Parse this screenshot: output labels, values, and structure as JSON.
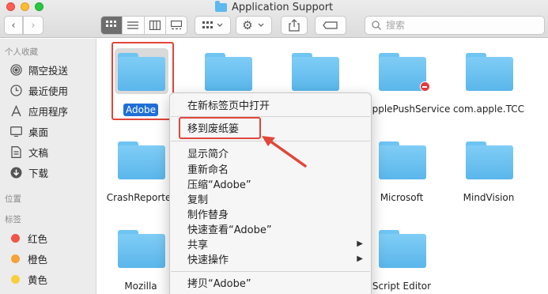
{
  "window": {
    "title": "Application Support"
  },
  "toolbar": {
    "back": "‹",
    "forward": "›",
    "view_modes": [
      "icon-view",
      "list-view",
      "column-view",
      "gallery-view"
    ],
    "search_placeholder": "搜索"
  },
  "sidebar": {
    "favorites_header": "个人收藏",
    "favorites": [
      {
        "label": "隔空投送",
        "icon": "airdrop-icon"
      },
      {
        "label": "最近使用",
        "icon": "clock-icon"
      },
      {
        "label": "应用程序",
        "icon": "apps-icon"
      },
      {
        "label": "桌面",
        "icon": "desktop-icon"
      },
      {
        "label": "文稿",
        "icon": "document-icon"
      },
      {
        "label": "下载",
        "icon": "download-icon"
      }
    ],
    "locations_header": "位置",
    "tags_header": "标签",
    "tags": [
      {
        "label": "红色",
        "color": "#f0544a"
      },
      {
        "label": "橙色",
        "color": "#f5a23a"
      },
      {
        "label": "黄色",
        "color": "#f6cf3c"
      }
    ]
  },
  "files": [
    {
      "label": "Adobe",
      "selected": true
    },
    {
      "label": ""
    },
    {
      "label": ""
    },
    {
      "label": "pplePushService",
      "no_entry": true
    },
    {
      "label": "com.apple.TCC"
    },
    {
      "label": "CrashReporter"
    },
    {
      "label": "Microsoft"
    },
    {
      "label": "MindVision"
    },
    {
      "label": "Mozilla"
    },
    {
      "label": "Script Editor"
    }
  ],
  "context_menu": {
    "open_new_tab": "在新标签页中打开",
    "move_to_trash": "移到废纸篓",
    "get_info": "显示简介",
    "rename": "重新命名",
    "compress": "压缩“Adobe”",
    "duplicate": "复制",
    "make_alias": "制作替身",
    "quick_look": "快速查看“Adobe”",
    "share": "共享",
    "quick_actions": "快速操作",
    "copy": "拷贝“Adobe”"
  }
}
